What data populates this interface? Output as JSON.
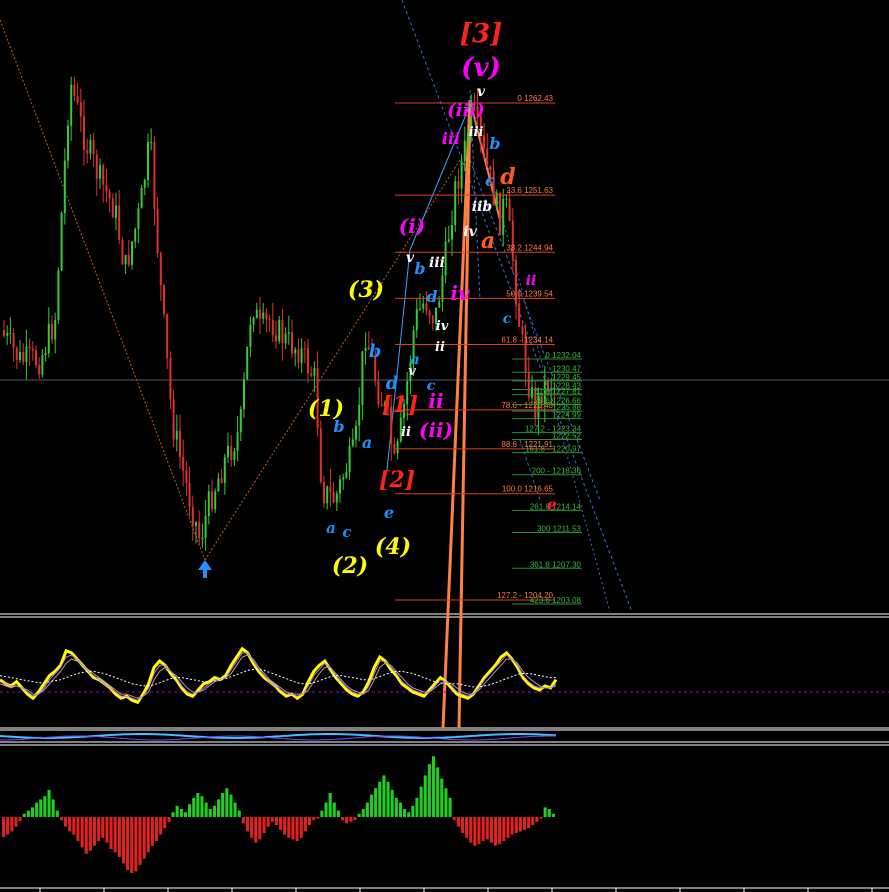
{
  "chart_data": [
    {
      "type": "candlestick",
      "title": "",
      "xlabel": "",
      "ylabel": "",
      "ylim": [
        1203,
        1264
      ],
      "up_color": "#32cd32",
      "down_color": "#e0302a",
      "fib_levels_upper": [
        {
          "label": "0 1262.43",
          "price": 1262.43
        },
        {
          "label": "23.6 1251.63",
          "price": 1251.63
        },
        {
          "label": "38.2 1244.94",
          "price": 1244.94
        },
        {
          "label": "50.0 1239.54",
          "price": 1239.54
        },
        {
          "label": "61.8 - 1234.14",
          "price": 1234.14
        },
        {
          "label": "78.6 - 1226.48",
          "price": 1226.48
        },
        {
          "label": "88.6 - 1221.91",
          "price": 1221.91
        },
        {
          "label": "100.0 1216.65",
          "price": 1216.65
        },
        {
          "label": "127.2 - 1204.20",
          "price": 1204.2
        }
      ],
      "fib_levels_lower": [
        {
          "label": "0 1232.04",
          "price": 1232.04
        },
        {
          "label": "1230.47",
          "price": 1230.47
        },
        {
          "label": "1229.45",
          "price": 1229.45
        },
        {
          "label": "1228.43",
          "price": 1228.43
        },
        {
          "label": "61.8 1227.81",
          "price": 1227.81
        },
        {
          "label": "78.6 1226.66",
          "price": 1226.66
        },
        {
          "label": "1225.88",
          "price": 1225.88
        },
        {
          "label": "1224.99",
          "price": 1224.99
        },
        {
          "label": "127.2 - 1223.34",
          "price": 1223.34
        },
        {
          "label": "1222.52",
          "price": 1222.52
        },
        {
          "label": "161.8 - 1220.97",
          "price": 1220.97
        },
        {
          "label": "200 - 1218.36",
          "price": 1218.36
        },
        {
          "label": "261.8 1214.14",
          "price": 1214.14
        },
        {
          "label": "300 1211.53",
          "price": 1211.53
        },
        {
          "label": "361.8 1207.30",
          "price": 1207.3
        },
        {
          "label": "423.6 1203.08",
          "price": 1203.08
        }
      ],
      "wave_labels": [
        {
          "text": "[3]",
          "color": "#ff2020",
          "size": 26
        },
        {
          "text": "(v)",
          "color": "#ff00ff",
          "size": 26
        },
        {
          "text": "(iii)",
          "color": "#ff00ff",
          "size": 18
        },
        {
          "text": "v",
          "color": "#ffffff",
          "size": 14
        },
        {
          "text": "iii",
          "color": "#ff00ff",
          "size": 16
        },
        {
          "text": "iii",
          "color": "#ffffff",
          "size": 13
        },
        {
          "text": "b",
          "color": "#1e90ff",
          "size": 16
        },
        {
          "text": "c",
          "color": "#1e90ff",
          "size": 16
        },
        {
          "text": "d",
          "color": "#ff5a1f",
          "size": 22
        },
        {
          "text": "iib",
          "color": "#ffffff",
          "size": 14
        },
        {
          "text": "a",
          "color": "#ff5a1f",
          "size": 22
        },
        {
          "text": "(i)",
          "color": "#ff00ff",
          "size": 20
        },
        {
          "text": "iv",
          "color": "#ffffff",
          "size": 14
        },
        {
          "text": "v",
          "color": "#ffffff",
          "size": 14
        },
        {
          "text": "iii",
          "color": "#ffffff",
          "size": 14
        },
        {
          "text": "b",
          "color": "#1e90ff",
          "size": 16
        },
        {
          "text": "iv",
          "color": "#ff00ff",
          "size": 20
        },
        {
          "text": "(3)",
          "color": "#ffff00",
          "size": 22
        },
        {
          "text": "d",
          "color": "#1e90ff",
          "size": 16
        },
        {
          "text": "iv",
          "color": "#ffffff",
          "size": 13
        },
        {
          "text": "b",
          "color": "#1e90ff",
          "size": 18
        },
        {
          "text": "a",
          "color": "#1e90ff",
          "size": 14
        },
        {
          "text": "v",
          "color": "#ffffff",
          "size": 13
        },
        {
          "text": "ii",
          "color": "#ffffff",
          "size": 13
        },
        {
          "text": "d",
          "color": "#1e90ff",
          "size": 18
        },
        {
          "text": "c",
          "color": "#1e90ff",
          "size": 14
        },
        {
          "text": "ii",
          "color": "#ff00ff",
          "size": 20
        },
        {
          "text": "[1]",
          "color": "#ff2020",
          "size": 22
        },
        {
          "text": "(1)",
          "color": "#ffff00",
          "size": 22
        },
        {
          "text": "b",
          "color": "#1e90ff",
          "size": 16
        },
        {
          "text": "a",
          "color": "#1e90ff",
          "size": 16
        },
        {
          "text": "ii",
          "color": "#ffffff",
          "size": 13
        },
        {
          "text": "(ii)",
          "color": "#ff00ff",
          "size": 20
        },
        {
          "text": "[2]",
          "color": "#ff2020",
          "size": 22
        },
        {
          "text": "e",
          "color": "#1e90ff",
          "size": 16
        },
        {
          "text": "a",
          "color": "#1e90ff",
          "size": 15
        },
        {
          "text": "c",
          "color": "#1e90ff",
          "size": 15
        },
        {
          "text": "(2)",
          "color": "#ffff00",
          "size": 22
        },
        {
          "text": "(4)",
          "color": "#ffff00",
          "size": 22
        },
        {
          "text": "c",
          "color": "#1e90ff",
          "size": 14
        },
        {
          "text": "ii",
          "color": "#ff00ff",
          "size": 14
        },
        {
          "text": "e",
          "color": "#ff2020",
          "size": 16
        }
      ],
      "arrow_color": "#2b8cff",
      "crosshair_color": "#4a5a6a"
    },
    {
      "type": "line",
      "title": "",
      "ylim": [
        0,
        100
      ],
      "series": [
        {
          "color": "#ffff00",
          "values": [
            44,
            40,
            38,
            42,
            36,
            30,
            26,
            32,
            40,
            48,
            52,
            58,
            72,
            70,
            64,
            58,
            52,
            46,
            44,
            40,
            36,
            30,
            26,
            28,
            24,
            22,
            30,
            40,
            56,
            62,
            58,
            50,
            44,
            36,
            30,
            28,
            34,
            40,
            42,
            46,
            44,
            48,
            58,
            66,
            74,
            70,
            60,
            52,
            46,
            42,
            38,
            32,
            28,
            30,
            26,
            30,
            42,
            52,
            58,
            62,
            54,
            46,
            40,
            34,
            30,
            28,
            32,
            42,
            56,
            66,
            62,
            54,
            48,
            40,
            36,
            32,
            30,
            28,
            34,
            40,
            46,
            42,
            36,
            30,
            28,
            26,
            30,
            38,
            46,
            52,
            58,
            66,
            70,
            64,
            56,
            46,
            40,
            36,
            34,
            38,
            36,
            44
          ]
        },
        {
          "color": "#d070d0",
          "values": [
            40,
            38,
            36,
            38,
            36,
            32,
            28,
            30,
            36,
            44,
            50,
            56,
            66,
            68,
            64,
            58,
            52,
            48,
            44,
            40,
            36,
            32,
            28,
            28,
            26,
            24,
            28,
            36,
            50,
            58,
            58,
            52,
            46,
            38,
            32,
            30,
            32,
            36,
            40,
            44,
            44,
            46,
            54,
            62,
            70,
            70,
            62,
            54,
            48,
            42,
            38,
            34,
            30,
            30,
            28,
            30,
            38,
            48,
            54,
            60,
            56,
            48,
            42,
            36,
            32,
            30,
            30,
            38,
            50,
            62,
            62,
            56,
            50,
            42,
            38,
            34,
            32,
            30,
            32,
            38,
            44,
            42,
            38,
            32,
            30,
            28,
            30,
            36,
            44,
            50,
            56,
            62,
            68,
            64,
            58,
            48,
            42,
            38,
            36,
            36,
            36,
            40
          ]
        },
        {
          "color": "#a0a0a0",
          "values": [
            42,
            40,
            38,
            38,
            36,
            34,
            30,
            30,
            34,
            40,
            46,
            52,
            60,
            64,
            62,
            58,
            54,
            50,
            46,
            42,
            38,
            34,
            30,
            30,
            28,
            26,
            28,
            32,
            44,
            52,
            56,
            52,
            48,
            42,
            36,
            32,
            32,
            34,
            38,
            42,
            44,
            46,
            50,
            58,
            66,
            68,
            64,
            56,
            50,
            44,
            40,
            36,
            32,
            30,
            30,
            30,
            34,
            42,
            50,
            56,
            56,
            50,
            44,
            38,
            34,
            32,
            30,
            34,
            44,
            56,
            60,
            58,
            52,
            46,
            40,
            36,
            34,
            32,
            32,
            36,
            40,
            42,
            40,
            36,
            32,
            30,
            30,
            34,
            40,
            46,
            52,
            58,
            64,
            64,
            60,
            52,
            46,
            42,
            38,
            36,
            36,
            38
          ]
        },
        {
          "color": "#ffffff",
          "values": [
            48,
            47,
            46,
            45,
            44,
            43,
            42,
            41,
            41,
            42,
            43,
            44,
            46,
            48,
            50,
            51,
            52,
            52,
            51,
            50,
            48,
            46,
            44,
            42,
            40,
            39,
            38,
            38,
            39,
            41,
            43,
            45,
            46,
            46,
            45,
            44,
            43,
            42,
            42,
            43,
            44,
            45,
            47,
            49,
            51,
            53,
            54,
            54,
            53,
            51,
            49,
            47,
            45,
            43,
            41,
            40,
            40,
            41,
            43,
            45,
            47,
            48,
            48,
            47,
            46,
            45,
            44,
            44,
            45,
            47,
            49,
            51,
            52,
            52,
            51,
            50,
            48,
            46,
            44,
            42,
            41,
            40,
            40,
            40,
            39,
            38,
            37,
            37,
            38,
            39,
            41,
            43,
            45,
            47,
            49,
            50,
            50,
            49,
            48,
            47,
            46,
            46
          ]
        }
      ]
    },
    {
      "type": "bar",
      "title": "",
      "up_color": "#22cc22",
      "down_color": "#dd2222",
      "values": [
        -25,
        -22,
        -18,
        -12,
        -5,
        4,
        8,
        12,
        18,
        22,
        26,
        34,
        22,
        8,
        -4,
        -12,
        -18,
        -22,
        -30,
        -38,
        -46,
        -42,
        -36,
        -30,
        -26,
        -32,
        -40,
        -44,
        -50,
        -58,
        -66,
        -70,
        -68,
        -60,
        -52,
        -44,
        -36,
        -30,
        -22,
        -14,
        -6,
        6,
        14,
        10,
        6,
        16,
        24,
        30,
        26,
        18,
        10,
        14,
        22,
        30,
        36,
        28,
        18,
        8,
        -8,
        -18,
        -26,
        -32,
        -28,
        -20,
        -12,
        -6,
        -10,
        -16,
        -22,
        -26,
        -28,
        -30,
        -26,
        -18,
        -10,
        -4,
        -2,
        8,
        18,
        30,
        18,
        8,
        -4,
        -8,
        -6,
        -4,
        4,
        10,
        18,
        28,
        36,
        44,
        52,
        44,
        34,
        24,
        18,
        10,
        6,
        14,
        24,
        38,
        52,
        66,
        76,
        62,
        48,
        36,
        24,
        -4,
        -12,
        -20,
        -26,
        -32,
        -36,
        -34,
        -30,
        -28,
        -32,
        -36,
        -34,
        -30,
        -26,
        -22,
        -20,
        -18,
        -16,
        -14,
        -10,
        -6,
        -2,
        12,
        10,
        4
      ]
    }
  ]
}
